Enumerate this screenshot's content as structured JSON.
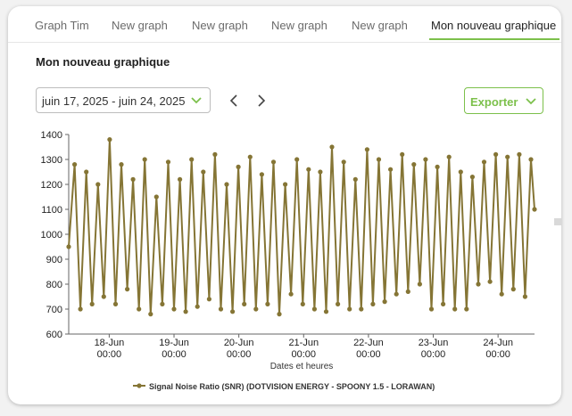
{
  "tabs": [
    {
      "label": "Graph Tim"
    },
    {
      "label": "New graph"
    },
    {
      "label": "New graph"
    },
    {
      "label": "New graph"
    },
    {
      "label": "New graph"
    },
    {
      "label": "Mon nouveau graphique"
    }
  ],
  "active_tab": 5,
  "page_title": "Mon nouveau graphique",
  "date_range": {
    "value": "juin 17, 2025 - juin 24, 2025",
    "icon": "chevron-down-icon"
  },
  "nav": {
    "prev_icon": "chevron-left-icon",
    "next_icon": "chevron-right-icon"
  },
  "export": {
    "label": "Exporter",
    "icon": "chevron-down-icon"
  },
  "colors": {
    "accent": "#7cc04b",
    "series": "#857535"
  },
  "chart_data": {
    "type": "line",
    "title": "",
    "xlabel": "Dates et heures",
    "ylabel": "",
    "ylim": [
      600,
      1400
    ],
    "yticks": [
      "600",
      "700",
      "800",
      "900",
      "1000",
      "1100",
      "1200",
      "1300",
      "1400"
    ],
    "xlim": [
      "2025-06-17T09:00",
      "2025-06-24T13:30"
    ],
    "xticks": [
      {
        "date": "18-Jun",
        "time": "00:00"
      },
      {
        "date": "19-Jun",
        "time": "00:00"
      },
      {
        "date": "20-Jun",
        "time": "00:00"
      },
      {
        "date": "21-Jun",
        "time": "00:00"
      },
      {
        "date": "22-Jun",
        "time": "00:00"
      },
      {
        "date": "23-Jun",
        "time": "00:00"
      },
      {
        "date": "24-Jun",
        "time": "00:00"
      }
    ],
    "legend_position": "bottom",
    "series": [
      {
        "name": "Signal Noise Ratio (SNR) (DOTVISION ENERGY - SPOONY 1.5 - LORAWAN)",
        "color": "#857535",
        "x": [
          "2025-06-17T09:00",
          "2025-06-17T11:10",
          "2025-06-17T13:20",
          "2025-06-17T15:30",
          "2025-06-17T17:40",
          "2025-06-17T19:50",
          "2025-06-17T22:00",
          "2025-06-18T00:10",
          "2025-06-18T02:20",
          "2025-06-18T04:30",
          "2025-06-18T06:40",
          "2025-06-18T08:50",
          "2025-06-18T11:00",
          "2025-06-18T13:10",
          "2025-06-18T15:20",
          "2025-06-18T17:30",
          "2025-06-18T19:40",
          "2025-06-18T21:50",
          "2025-06-19T00:00",
          "2025-06-19T02:10",
          "2025-06-19T04:20",
          "2025-06-19T06:30",
          "2025-06-19T08:40",
          "2025-06-19T10:50",
          "2025-06-19T13:00",
          "2025-06-19T15:10",
          "2025-06-19T17:20",
          "2025-06-19T19:30",
          "2025-06-19T21:40",
          "2025-06-19T23:50",
          "2025-06-20T02:00",
          "2025-06-20T04:10",
          "2025-06-20T06:20",
          "2025-06-20T08:30",
          "2025-06-20T10:40",
          "2025-06-20T12:50",
          "2025-06-20T15:00",
          "2025-06-20T17:10",
          "2025-06-20T19:20",
          "2025-06-20T21:30",
          "2025-06-20T23:40",
          "2025-06-21T01:50",
          "2025-06-21T04:00",
          "2025-06-21T06:10",
          "2025-06-21T08:20",
          "2025-06-21T10:30",
          "2025-06-21T12:40",
          "2025-06-21T14:50",
          "2025-06-21T17:00",
          "2025-06-21T19:10",
          "2025-06-21T21:20",
          "2025-06-21T23:30",
          "2025-06-22T01:40",
          "2025-06-22T03:50",
          "2025-06-22T06:00",
          "2025-06-22T08:10",
          "2025-06-22T10:20",
          "2025-06-22T12:30",
          "2025-06-22T14:40",
          "2025-06-22T16:50",
          "2025-06-22T19:00",
          "2025-06-22T21:10",
          "2025-06-22T23:20",
          "2025-06-23T01:30",
          "2025-06-23T03:40",
          "2025-06-23T05:50",
          "2025-06-23T08:00",
          "2025-06-23T10:10",
          "2025-06-23T12:20",
          "2025-06-23T14:30",
          "2025-06-23T16:40",
          "2025-06-23T18:50",
          "2025-06-23T21:00",
          "2025-06-23T23:10",
          "2025-06-24T01:20",
          "2025-06-24T03:30",
          "2025-06-24T05:40",
          "2025-06-24T07:50",
          "2025-06-24T10:00",
          "2025-06-24T12:10",
          "2025-06-24T13:30"
        ],
        "values": [
          950,
          1280,
          700,
          1250,
          720,
          1200,
          750,
          1380,
          720,
          1280,
          780,
          1220,
          700,
          1300,
          680,
          1150,
          720,
          1290,
          700,
          1220,
          690,
          1300,
          710,
          1250,
          740,
          1320,
          700,
          1200,
          690,
          1270,
          720,
          1310,
          700,
          1240,
          720,
          1290,
          680,
          1200,
          760,
          1300,
          720,
          1260,
          700,
          1250,
          690,
          1350,
          720,
          1290,
          700,
          1220,
          700,
          1340,
          720,
          1300,
          730,
          1260,
          760,
          1320,
          770,
          1280,
          800,
          1300,
          700,
          1270,
          720,
          1310,
          700,
          1250,
          700,
          1230,
          800,
          1290,
          810,
          1320,
          760,
          1310,
          780,
          1320,
          750,
          1300,
          1100
        ]
      }
    ]
  }
}
